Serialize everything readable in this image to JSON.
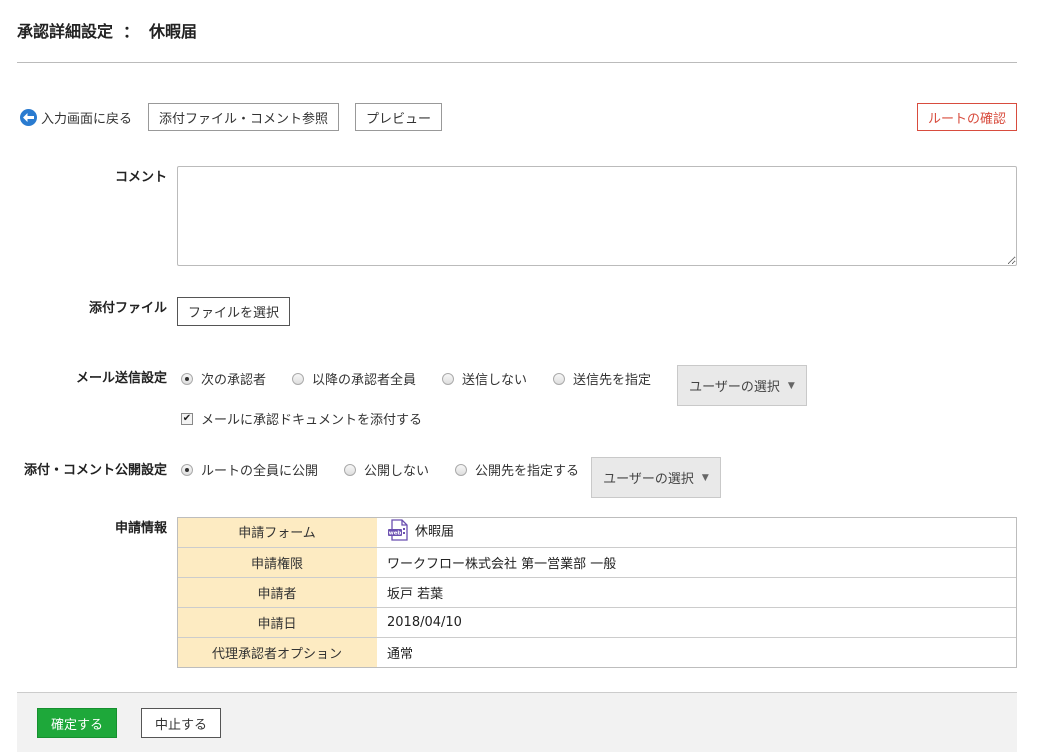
{
  "header": {
    "title": "承認詳細設定",
    "separator": "：",
    "subtitle": "休暇届"
  },
  "toolbar": {
    "back_label": "入力画面に戻る",
    "attachments_comments_label": "添付ファイル・コメント参照",
    "preview_label": "プレビュー",
    "route_confirm_label": "ルートの確認"
  },
  "colors": {
    "accent_green": "#1ea83a",
    "route_red": "#d84c3e",
    "info_key_bg": "#fdebc2",
    "back_icon_blue": "#2a7bd0"
  },
  "form": {
    "comment": {
      "label": "コメント",
      "value": ""
    },
    "attachment": {
      "label": "添付ファイル",
      "button_label": "ファイルを選択"
    },
    "mail": {
      "label": "メール送信設定",
      "options": [
        "次の承認者",
        "以降の承認者全員",
        "送信しない",
        "送信先を指定"
      ],
      "selected": "次の承認者",
      "user_select_label": "ユーザーの選択",
      "attach_doc_label": "メールに承認ドキュメントを添付する",
      "attach_doc_checked": true
    },
    "publish": {
      "label": "添付・コメント公開設定",
      "options": [
        "ルートの全員に公開",
        "公開しない",
        "公開先を指定する"
      ],
      "selected": "ルートの全員に公開",
      "user_select_label": "ユーザーの選択"
    },
    "info": {
      "label": "申請情報",
      "rows": [
        {
          "key": "申請フォーム",
          "value": "休暇届",
          "icon": "web-form-icon"
        },
        {
          "key": "申請権限",
          "value": "ワークフロー株式会社 第一営業部 一般"
        },
        {
          "key": "申請者",
          "value": "坂戸 若葉"
        },
        {
          "key": "申請日",
          "value": "2018/04/10"
        },
        {
          "key": "代理承認者オプション",
          "value": "通常"
        }
      ]
    }
  },
  "footer": {
    "confirm_label": "確定する",
    "cancel_label": "中止する"
  }
}
